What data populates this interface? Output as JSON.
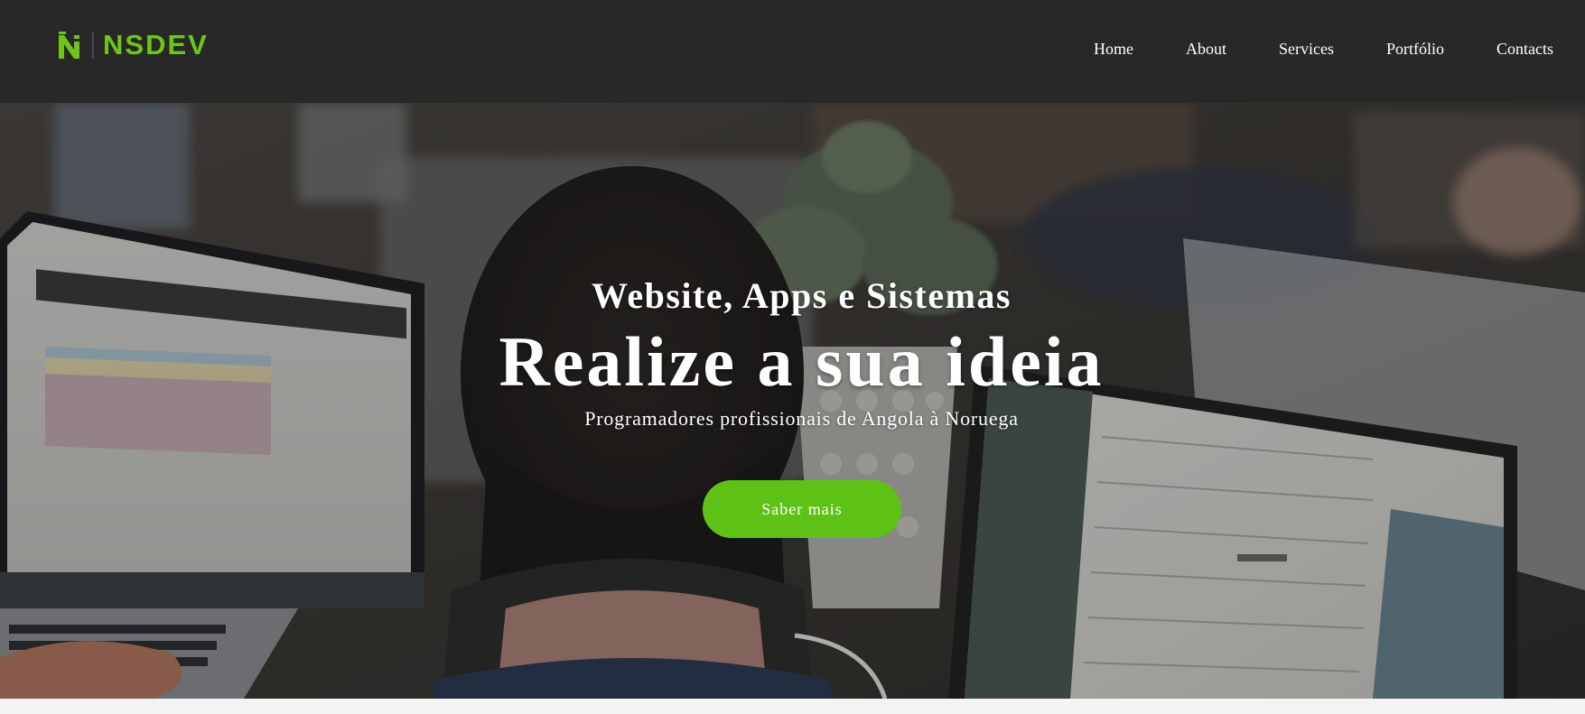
{
  "brand": {
    "logo_text": "NSDEV",
    "accent_color": "#6ec51b"
  },
  "nav": {
    "items": [
      {
        "label": "Home"
      },
      {
        "label": "About"
      },
      {
        "label": "Services"
      },
      {
        "label": "Portfólio"
      },
      {
        "label": "Contacts"
      }
    ]
  },
  "hero": {
    "subtitle": "Website, Apps e Sistemas",
    "title": "Realize a sua ideia",
    "tagline": "Programadores profissionais de Angola à Noruega",
    "cta_label": "Saber mais",
    "cta_color": "#5ec216"
  },
  "icons": {
    "logo_mark": "n-monogram-icon"
  }
}
